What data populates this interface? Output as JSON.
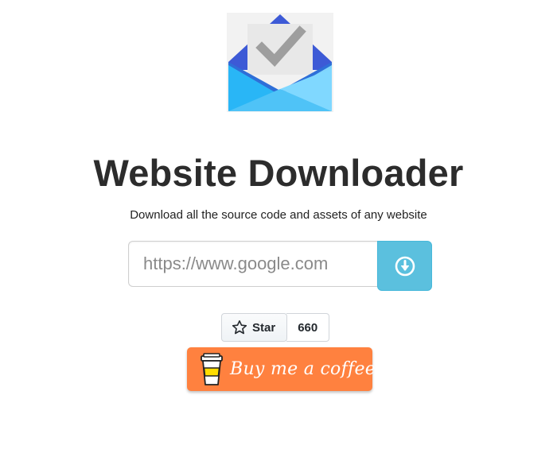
{
  "app": {
    "logo_icon": "inbox-envelope-check-icon",
    "title": "Website Downloader",
    "subtitle": "Download all the source code and assets of any website"
  },
  "form": {
    "url_placeholder": "https://www.google.com",
    "url_value": "",
    "download_icon": "arrow-down-circle-icon"
  },
  "github": {
    "star_icon": "star-outline-icon",
    "star_label": "Star",
    "star_count": "660"
  },
  "coffee": {
    "icon": "coffee-cup-icon",
    "label": "Buy me a coffee"
  },
  "colors": {
    "accent": "#5bc0de",
    "coffee": "#ff813f",
    "logo_blue_dark": "#3b5bdb",
    "logo_blue_light": "#4fc3f7"
  }
}
